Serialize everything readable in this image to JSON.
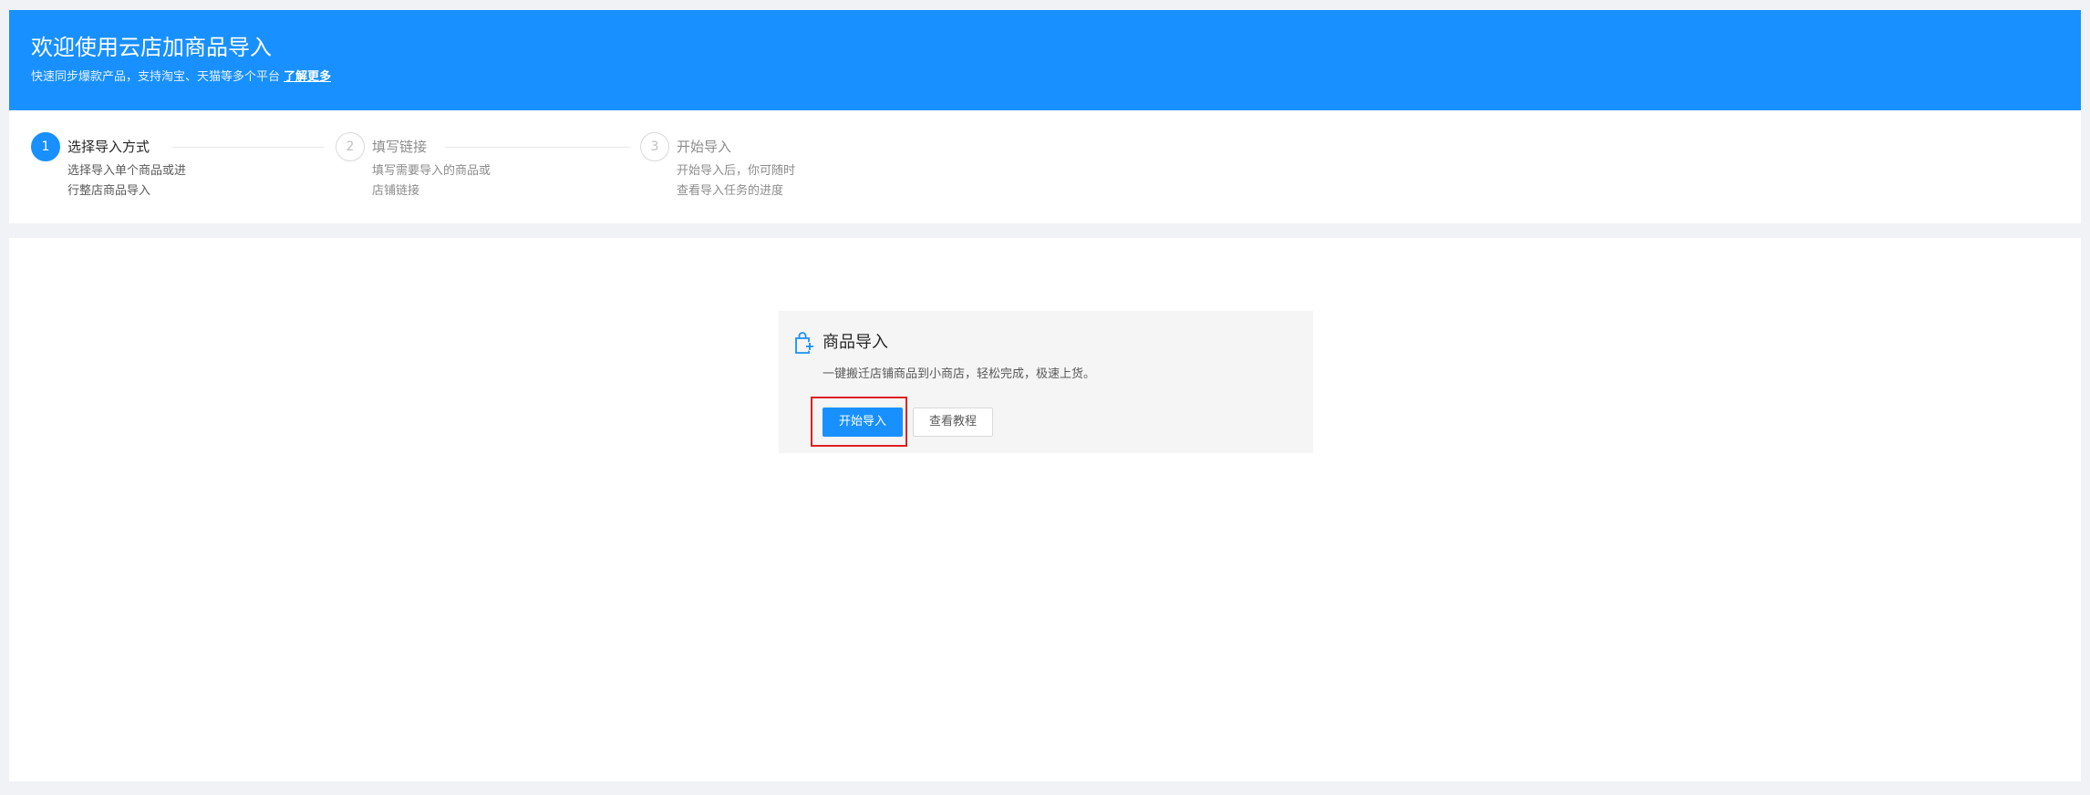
{
  "banner": {
    "title": "欢迎使用云店加商品导入",
    "subtitle": "快速同步爆款产品，支持淘宝、天猫等多个平台",
    "link": "了解更多",
    "bg_color": "#1890ff"
  },
  "steps": [
    {
      "number": "1",
      "title": "选择导入方式",
      "desc_line1": "选择导入单个商品或进",
      "desc_line2": "行整店商品导入",
      "status": "active"
    },
    {
      "number": "2",
      "title": "填写链接",
      "desc_line1": "填写需要导入的商品或",
      "desc_line2": "店铺链接",
      "status": "wait"
    },
    {
      "number": "3",
      "title": "开始导入",
      "desc_line1": "开始导入后，你可随时",
      "desc_line2": "查看导入任务的进度",
      "status": "wait"
    }
  ],
  "card": {
    "icon": "shopping-bag-plus-icon",
    "title": "商品导入",
    "desc": "一键搬迁店铺商品到小商店，轻松完成，极速上货。",
    "primary_button": "开始导入",
    "secondary_button": "查看教程"
  },
  "accent_color": "#1890ff",
  "highlight_color": "#e02020"
}
